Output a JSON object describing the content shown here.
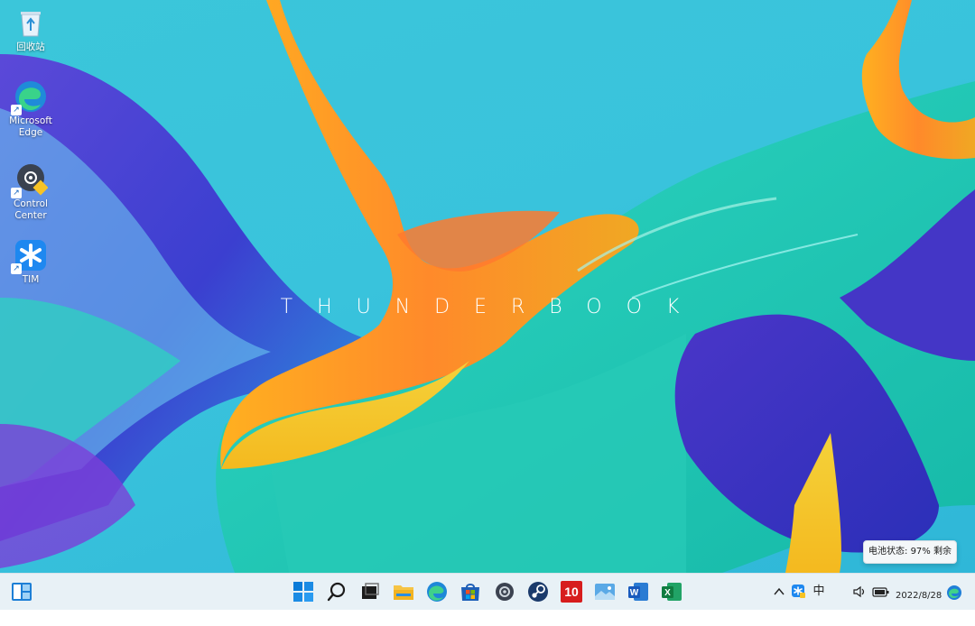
{
  "wallpaper": {
    "brand_text": "THUNDERBOOK"
  },
  "desktop_icons": [
    {
      "label": "回收站",
      "icon": "recycle-bin-icon"
    },
    {
      "label": "Microsoft Edge",
      "icon": "edge-icon"
    },
    {
      "label": "Control Center",
      "icon": "control-center-icon"
    },
    {
      "label": "TIM",
      "icon": "tim-icon"
    }
  ],
  "taskbar": {
    "widgets": "widgets-icon",
    "apps": [
      "start-icon",
      "search-icon",
      "task-view-icon",
      "file-explorer-icon",
      "edge-icon",
      "store-icon",
      "settings-icon",
      "steam-icon",
      "app-10-icon",
      "photos-icon",
      "word-icon",
      "excel-icon"
    ],
    "app10_label": "10",
    "tray": {
      "input_method": "中",
      "date": "2022/8/28"
    }
  },
  "tooltip": {
    "battery_status": "电池状态: 97% 剩余"
  },
  "colors": {
    "accent": "#0067c0",
    "taskbar": "#e7f0f6"
  }
}
